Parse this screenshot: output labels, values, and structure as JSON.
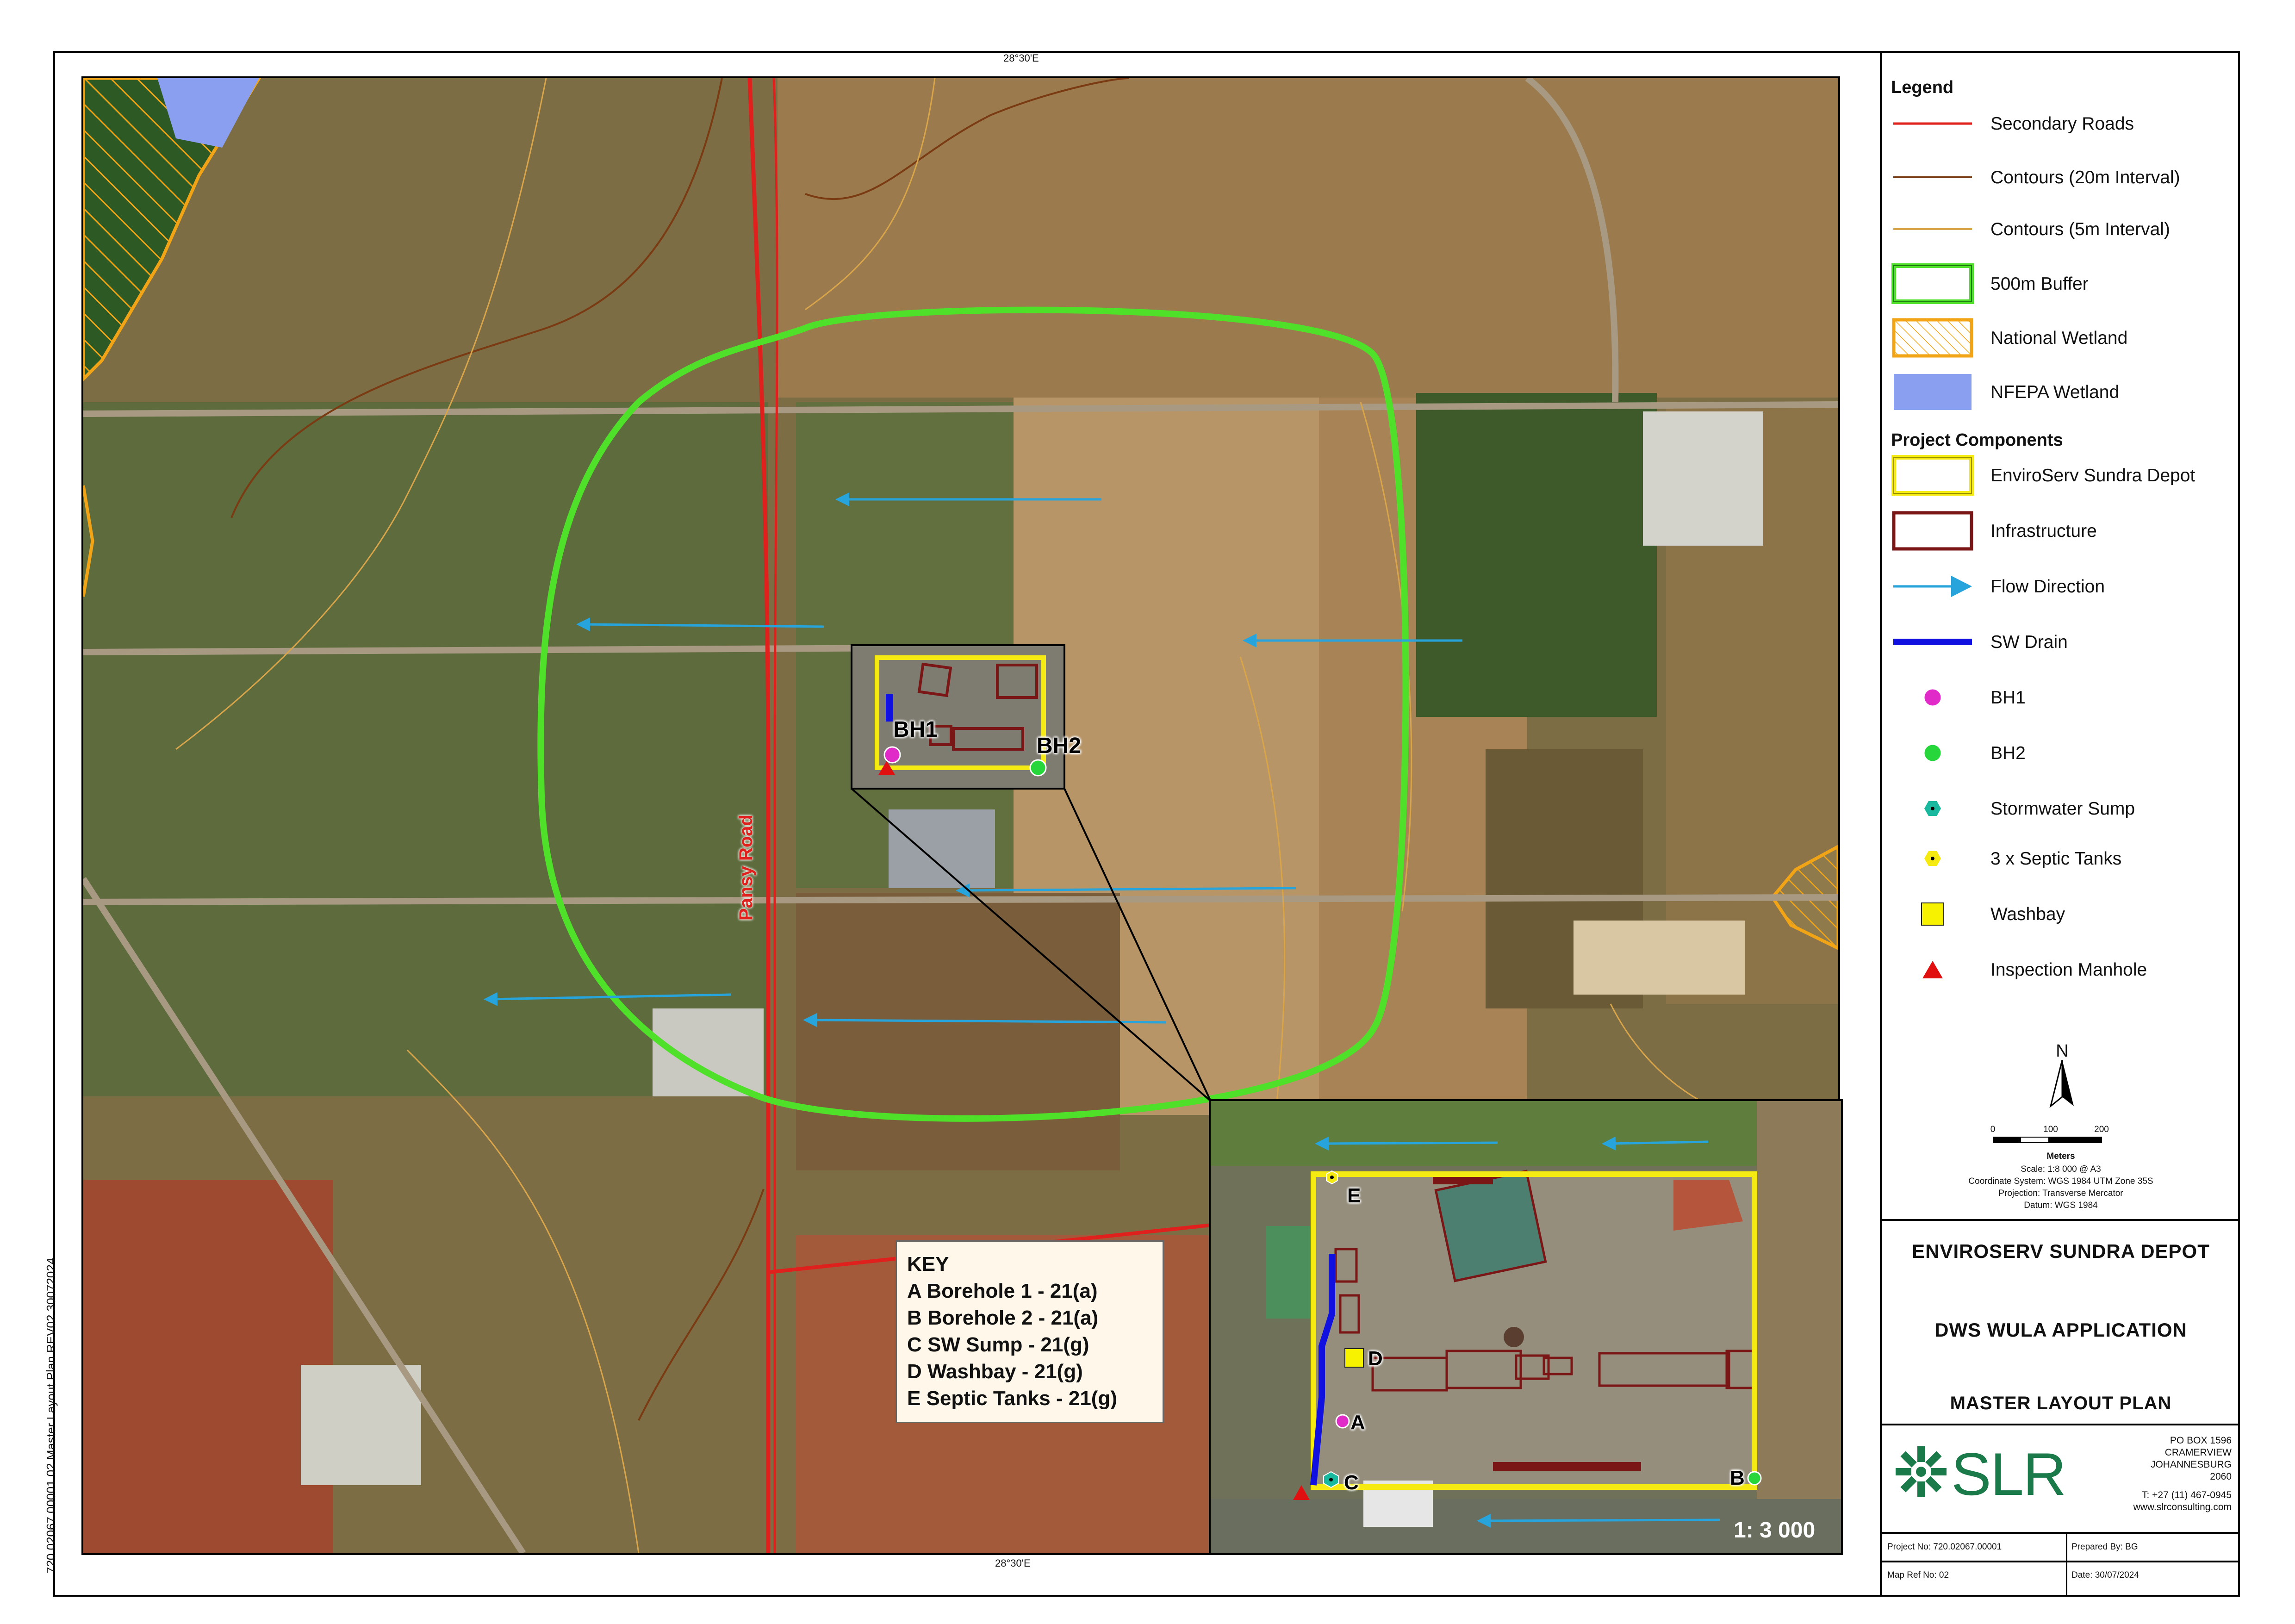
{
  "graticule": {
    "top": "28°30'E",
    "bottom": "28°30'E"
  },
  "side_label": "720.02067.00001 02 Master Layout Plan  REV02  30072024",
  "map_labels": {
    "road": "Pansy Road",
    "bh1": "BH1",
    "bh2": "BH2",
    "inset_scale": "1: 3 000",
    "inset_a": "A",
    "inset_b": "B",
    "inset_c": "C",
    "inset_d": "D",
    "inset_e": "E"
  },
  "key": {
    "title": "KEY",
    "items": [
      "A  Borehole 1 - 21(a)",
      "B  Borehole 2 - 21(a)",
      "C  SW Sump - 21(g)",
      "D  Washbay - 21(g)",
      "E  Septic Tanks - 21(g)"
    ]
  },
  "legend": {
    "title": "Legend",
    "items": [
      {
        "label": "Secondary Roads",
        "icon": "red-line"
      },
      {
        "label": "Contours (20m Interval)",
        "icon": "brown-line"
      },
      {
        "label": "Contours (5m Interval)",
        "icon": "tan-line"
      },
      {
        "label": "500m Buffer",
        "icon": "green-box"
      },
      {
        "label": "National Wetland",
        "icon": "hatched-orange-box"
      },
      {
        "label": "NFEPA Wetland",
        "icon": "blue-box"
      }
    ],
    "components_title": "Project Components",
    "components": [
      {
        "label": "EnviroServ Sundra Depot",
        "icon": "yellow-box"
      },
      {
        "label": "Infrastructure",
        "icon": "maroon-box"
      },
      {
        "label": "Flow Direction",
        "icon": "arrow"
      },
      {
        "label": "SW Drain",
        "icon": "blue-line"
      },
      {
        "label": "BH1",
        "icon": "magenta-dot"
      },
      {
        "label": "BH2",
        "icon": "green-dot"
      },
      {
        "label": "Stormwater Sump",
        "icon": "teal-hexagon"
      },
      {
        "label": "3 x Septic Tanks",
        "icon": "yellow-hexagon"
      },
      {
        "label": "Washbay",
        "icon": "yellow-square"
      },
      {
        "label": "Inspection Manhole",
        "icon": "red-triangle"
      }
    ]
  },
  "north": "N",
  "scalebar": {
    "ticks": [
      "0",
      "100",
      "200"
    ],
    "unit": "Meters",
    "scale": "Scale:   1:8 000    @   A3",
    "crs": "Coordinate System: WGS 1984 UTM Zone 35S",
    "projection": "Projection: Transverse Mercator",
    "datum": "Datum: WGS 1984"
  },
  "titles": {
    "t1": "ENVIROSERV SUNDRA DEPOT",
    "t2": "DWS WULA APPLICATION",
    "t3": "MASTER LAYOUT PLAN"
  },
  "company": {
    "name": "SLR",
    "addr1": "PO BOX 1596",
    "addr2": "CRAMERVIEW",
    "addr3": "JOHANNESBURG",
    "addr4": "2060",
    "tel": "T: +27 (11) 467-0945",
    "web": "www.slrconsulting.com"
  },
  "footer": {
    "project_no": "Project No:  720.02067.00001",
    "prepared_by": "Prepared By: BG",
    "map_ref": "Map Ref No: 02",
    "date": "Date: 30/07/2024"
  },
  "colors": {
    "secondary_road": "#e0201c",
    "contour20": "#7a3a12",
    "contour5": "#d9a54a",
    "buffer": "#4fe02a",
    "depot": "#f5ea12",
    "infrastructure": "#7a1616",
    "flow": "#27a4dc",
    "drain": "#1010e0",
    "bh1": "#e02bc8",
    "bh2": "#27d63a",
    "sump": "#19b9a0",
    "septic": "#f5ea12",
    "washbay": "#f7f300",
    "manhole": "#e01010",
    "nfepa": "#8a9ff0",
    "wetland": "#f2a417",
    "slr_green": "#1a7a4a"
  }
}
